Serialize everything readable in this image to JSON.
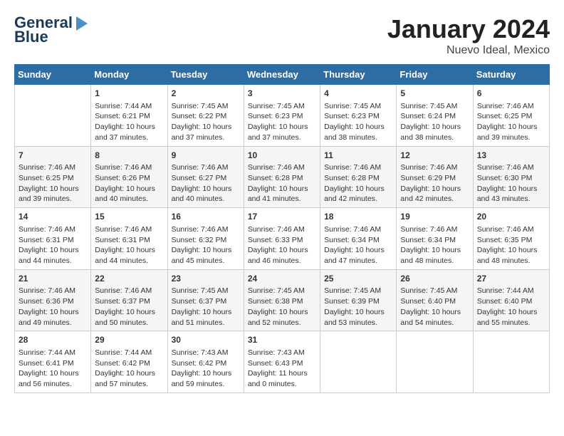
{
  "header": {
    "logo_line1": "General",
    "logo_line2": "Blue",
    "month_title": "January 2024",
    "location": "Nuevo Ideal, Mexico"
  },
  "weekdays": [
    "Sunday",
    "Monday",
    "Tuesday",
    "Wednesday",
    "Thursday",
    "Friday",
    "Saturday"
  ],
  "weeks": [
    [
      {
        "day": "",
        "data": ""
      },
      {
        "day": "1",
        "data": "Sunrise: 7:44 AM\nSunset: 6:21 PM\nDaylight: 10 hours\nand 37 minutes."
      },
      {
        "day": "2",
        "data": "Sunrise: 7:45 AM\nSunset: 6:22 PM\nDaylight: 10 hours\nand 37 minutes."
      },
      {
        "day": "3",
        "data": "Sunrise: 7:45 AM\nSunset: 6:23 PM\nDaylight: 10 hours\nand 37 minutes."
      },
      {
        "day": "4",
        "data": "Sunrise: 7:45 AM\nSunset: 6:23 PM\nDaylight: 10 hours\nand 38 minutes."
      },
      {
        "day": "5",
        "data": "Sunrise: 7:45 AM\nSunset: 6:24 PM\nDaylight: 10 hours\nand 38 minutes."
      },
      {
        "day": "6",
        "data": "Sunrise: 7:46 AM\nSunset: 6:25 PM\nDaylight: 10 hours\nand 39 minutes."
      }
    ],
    [
      {
        "day": "7",
        "data": "Sunrise: 7:46 AM\nSunset: 6:25 PM\nDaylight: 10 hours\nand 39 minutes."
      },
      {
        "day": "8",
        "data": "Sunrise: 7:46 AM\nSunset: 6:26 PM\nDaylight: 10 hours\nand 40 minutes."
      },
      {
        "day": "9",
        "data": "Sunrise: 7:46 AM\nSunset: 6:27 PM\nDaylight: 10 hours\nand 40 minutes."
      },
      {
        "day": "10",
        "data": "Sunrise: 7:46 AM\nSunset: 6:28 PM\nDaylight: 10 hours\nand 41 minutes."
      },
      {
        "day": "11",
        "data": "Sunrise: 7:46 AM\nSunset: 6:28 PM\nDaylight: 10 hours\nand 42 minutes."
      },
      {
        "day": "12",
        "data": "Sunrise: 7:46 AM\nSunset: 6:29 PM\nDaylight: 10 hours\nand 42 minutes."
      },
      {
        "day": "13",
        "data": "Sunrise: 7:46 AM\nSunset: 6:30 PM\nDaylight: 10 hours\nand 43 minutes."
      }
    ],
    [
      {
        "day": "14",
        "data": "Sunrise: 7:46 AM\nSunset: 6:31 PM\nDaylight: 10 hours\nand 44 minutes."
      },
      {
        "day": "15",
        "data": "Sunrise: 7:46 AM\nSunset: 6:31 PM\nDaylight: 10 hours\nand 44 minutes."
      },
      {
        "day": "16",
        "data": "Sunrise: 7:46 AM\nSunset: 6:32 PM\nDaylight: 10 hours\nand 45 minutes."
      },
      {
        "day": "17",
        "data": "Sunrise: 7:46 AM\nSunset: 6:33 PM\nDaylight: 10 hours\nand 46 minutes."
      },
      {
        "day": "18",
        "data": "Sunrise: 7:46 AM\nSunset: 6:34 PM\nDaylight: 10 hours\nand 47 minutes."
      },
      {
        "day": "19",
        "data": "Sunrise: 7:46 AM\nSunset: 6:34 PM\nDaylight: 10 hours\nand 48 minutes."
      },
      {
        "day": "20",
        "data": "Sunrise: 7:46 AM\nSunset: 6:35 PM\nDaylight: 10 hours\nand 48 minutes."
      }
    ],
    [
      {
        "day": "21",
        "data": "Sunrise: 7:46 AM\nSunset: 6:36 PM\nDaylight: 10 hours\nand 49 minutes."
      },
      {
        "day": "22",
        "data": "Sunrise: 7:46 AM\nSunset: 6:37 PM\nDaylight: 10 hours\nand 50 minutes."
      },
      {
        "day": "23",
        "data": "Sunrise: 7:45 AM\nSunset: 6:37 PM\nDaylight: 10 hours\nand 51 minutes."
      },
      {
        "day": "24",
        "data": "Sunrise: 7:45 AM\nSunset: 6:38 PM\nDaylight: 10 hours\nand 52 minutes."
      },
      {
        "day": "25",
        "data": "Sunrise: 7:45 AM\nSunset: 6:39 PM\nDaylight: 10 hours\nand 53 minutes."
      },
      {
        "day": "26",
        "data": "Sunrise: 7:45 AM\nSunset: 6:40 PM\nDaylight: 10 hours\nand 54 minutes."
      },
      {
        "day": "27",
        "data": "Sunrise: 7:44 AM\nSunset: 6:40 PM\nDaylight: 10 hours\nand 55 minutes."
      }
    ],
    [
      {
        "day": "28",
        "data": "Sunrise: 7:44 AM\nSunset: 6:41 PM\nDaylight: 10 hours\nand 56 minutes."
      },
      {
        "day": "29",
        "data": "Sunrise: 7:44 AM\nSunset: 6:42 PM\nDaylight: 10 hours\nand 57 minutes."
      },
      {
        "day": "30",
        "data": "Sunrise: 7:43 AM\nSunset: 6:42 PM\nDaylight: 10 hours\nand 59 minutes."
      },
      {
        "day": "31",
        "data": "Sunrise: 7:43 AM\nSunset: 6:43 PM\nDaylight: 11 hours\nand 0 minutes."
      },
      {
        "day": "",
        "data": ""
      },
      {
        "day": "",
        "data": ""
      },
      {
        "day": "",
        "data": ""
      }
    ]
  ]
}
